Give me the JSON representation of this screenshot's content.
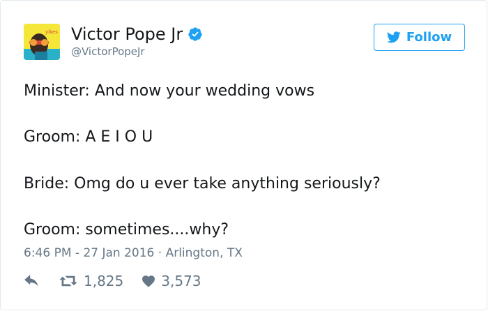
{
  "user": {
    "display_name": "Victor Pope Jr",
    "handle": "@VictorPopeJr",
    "verified": true,
    "avatar_text": "yikes"
  },
  "follow_button": {
    "label": "Follow"
  },
  "tweet": {
    "lines": [
      "Minister: And now your wedding vows",
      "Groom: A E I O U",
      "Bride: Omg do u ever take anything seriously?",
      "Groom: sometimes....why?"
    ],
    "time": "6:46 PM",
    "date": "27 Jan 2016",
    "location": "Arlington, TX"
  },
  "stats": {
    "retweets": "1,825",
    "likes": "3,573"
  },
  "colors": {
    "accent": "#1da1f2",
    "muted": "#657786",
    "text": "#14171a",
    "border": "#e1e8ed"
  },
  "icons": [
    "verified-badge-icon",
    "twitter-bird-icon",
    "reply-icon",
    "retweet-icon",
    "heart-icon"
  ]
}
